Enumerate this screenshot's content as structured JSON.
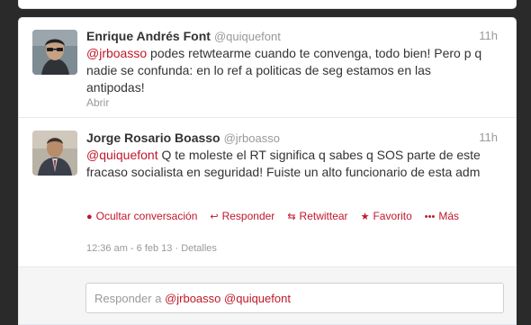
{
  "tweets": [
    {
      "fullname": "Enrique Andrés Font",
      "username": "@quiquefont",
      "time": "11h",
      "mention": "@jrboasso",
      "text": " podes retwtearme cuando te convenga, todo bien! Pero p q nadie se confunda: en lo ref a politicas de seg estamos en las antipodas!",
      "expand_label": "Abrir"
    },
    {
      "fullname": "Jorge Rosario Boasso",
      "username": "@jrboasso",
      "time": "11h",
      "mention": "@quiquefont",
      "text": " Q te moleste el RT significa q sabes q SOS parte de este fracaso socialista en seguridad! Fuiste un alto funcionario de esta adm",
      "actions": {
        "hide": "Ocultar conversación",
        "reply": "Responder",
        "retweet": "Retwittear",
        "favorite": "Favorito",
        "more": "Más"
      },
      "timestamp": "12:36 am - 6 feb 13",
      "details_sep": " · ",
      "details": "Detalles"
    }
  ],
  "reply_box": {
    "prefix": "Responder a ",
    "mention1": "@jrboasso",
    "mention2": "@quiquefont"
  },
  "colors": {
    "link": "#c0172a",
    "muted": "#999999",
    "text": "#333333"
  },
  "icons": {
    "hide": "speech-bubble-icon",
    "reply": "reply-arrow-icon",
    "retweet": "retweet-icon",
    "favorite": "star-icon",
    "more": "ellipsis-icon"
  }
}
